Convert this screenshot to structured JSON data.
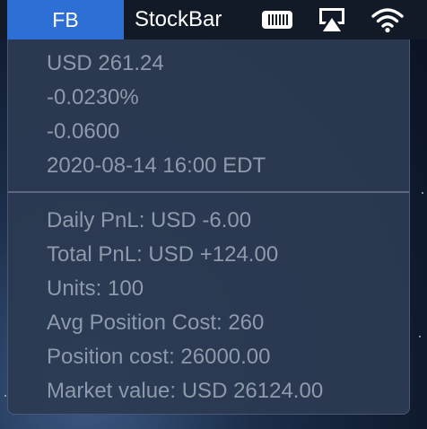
{
  "menubar": {
    "active_item": "FB",
    "app_title": "StockBar",
    "icons": [
      "battery-icon",
      "airplay-icon",
      "wifi-icon"
    ]
  },
  "quote": {
    "price": "USD 261.24",
    "change_percent": "-0.0230%",
    "change": "-0.0600",
    "timestamp": "2020-08-14 16:00 EDT"
  },
  "position": {
    "daily_pnl": "Daily PnL: USD -6.00",
    "total_pnl": "Total PnL: USD +124.00",
    "units": "Units: 100",
    "avg_cost": "Avg Position Cost: 260",
    "position_cost": "Position cost: 26000.00",
    "market_value": "Market value: USD 26124.00"
  },
  "colors": {
    "menubar_bg": "#121a28",
    "highlight": "#2e6fd6",
    "menu_bg": "#2c3a52",
    "menu_text": "#8e99ab",
    "divider": "#5b677c"
  }
}
